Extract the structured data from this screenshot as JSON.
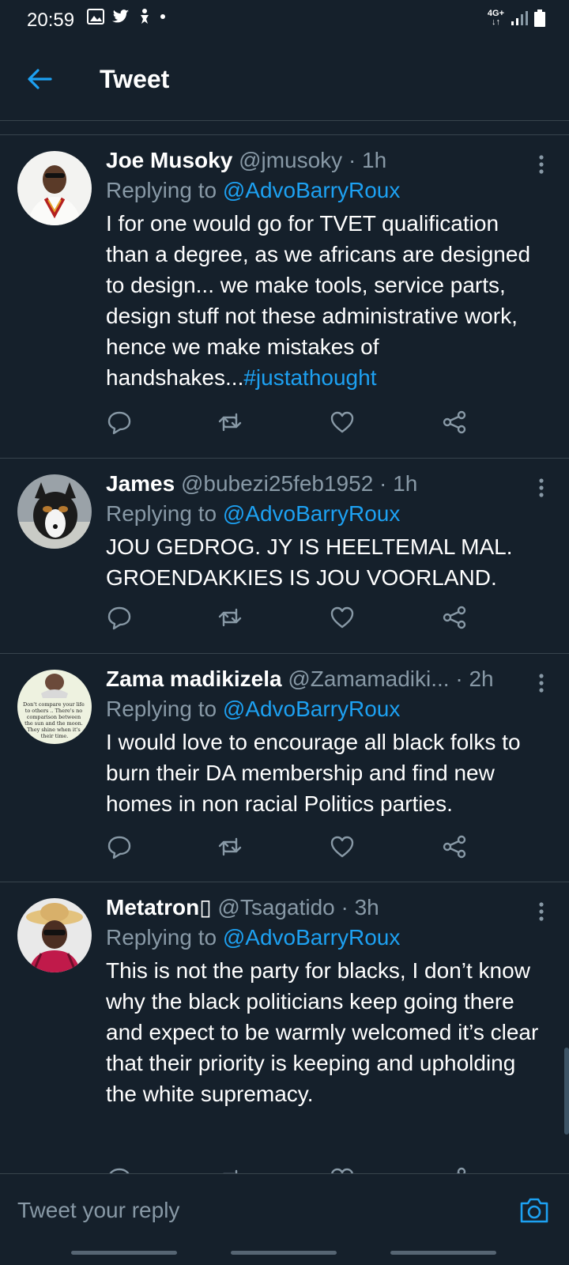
{
  "status_bar": {
    "time": "20:59",
    "network": "4G+"
  },
  "header": {
    "title": "Tweet"
  },
  "tweets": [
    {
      "name": "Joe Musoky",
      "handle": "@jmusoky · 1h",
      "replying_prefix": "Replying to ",
      "replying_to": "@AdvoBarryRoux",
      "text": "I for one would go for TVET qualification than a degree, as we africans are designed to design... we make tools, service parts, design stuff not these administrative work, hence we make mistakes of handshakes...",
      "hashtag": "#justathought"
    },
    {
      "name": "James",
      "handle": "@bubezi25feb1952 · 1h",
      "replying_prefix": "Replying to ",
      "replying_to": "@AdvoBarryRoux",
      "text": "JOU GEDROG. JY IS HEELTEMAL MAL. GROENDAKKIES IS JOU VOORLAND."
    },
    {
      "name": "Zama madikizela",
      "handle": "@Zamamadiki... · 2h",
      "replying_prefix": "Replying to ",
      "replying_to": "@AdvoBarryRoux",
      "text": "I would love to encourage all black folks to burn their DA membership and find new homes in non racial Politics parties.",
      "avatar_text": "Don't compare your life to others .. There's no comparison between the sun and the moon. They shine when it's their time."
    },
    {
      "name": "Metatron▯",
      "handle": "@Tsagatido · 3h",
      "replying_prefix": "Replying to ",
      "replying_to": "@AdvoBarryRoux",
      "text": "This is not the party for blacks, I don’t know why the black politicians keep going there and expect to be warmly welcomed it’s clear that their priority is keeping and upholding the white supremacy."
    }
  ],
  "reply_bar": {
    "placeholder": "Tweet your reply"
  },
  "colors": {
    "background": "#15202b",
    "accent": "#1da1f2",
    "muted": "#8899a6",
    "divider": "#38444d"
  },
  "icons": [
    "back-arrow-icon",
    "more-vert-icon",
    "reply-icon",
    "retweet-icon",
    "like-icon",
    "share-icon",
    "camera-icon"
  ]
}
